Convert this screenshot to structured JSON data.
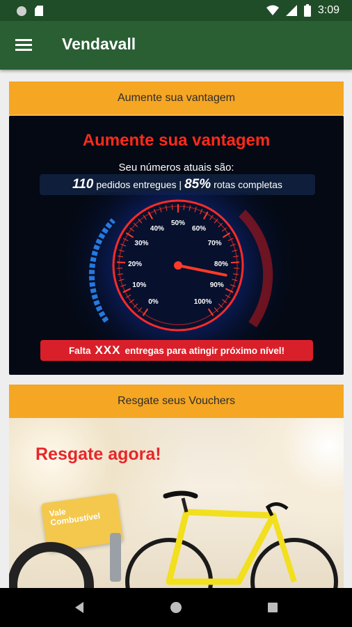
{
  "status_bar": {
    "time": "3:09",
    "left_icons": [
      "circle-icon",
      "sd-card-icon"
    ],
    "right_icons": [
      "wifi-icon",
      "signal-icon",
      "battery-icon"
    ]
  },
  "app_bar": {
    "title": "Vendavall",
    "menu_icon": "hamburger-menu-icon"
  },
  "colors": {
    "status_bar": "#1f4d27",
    "app_bar": "#2a5f34",
    "section_header": "#f5a623",
    "accent_red": "#e8262a"
  },
  "section1": {
    "header": "Aumente sua vantagem",
    "banner": {
      "headline": "Aumente sua vantagem",
      "subline": "Seu números atuais são:",
      "orders_count": "110",
      "orders_label": "pedidos entregues |",
      "routes_percent": "85%",
      "routes_label": "rotas completas",
      "gauge_labels": [
        "0%",
        "10%",
        "20%",
        "30%",
        "40%",
        "50%",
        "60%",
        "70%",
        "80%",
        "90%",
        "100%"
      ],
      "gauge_value_percent": 85,
      "cta_prefix": "Falta",
      "cta_count": "XXX",
      "cta_suffix": "entregas para atingir próximo nível!"
    }
  },
  "section2": {
    "header": "Resgate seus Vouchers",
    "banner": {
      "headline": "Resgate agora!",
      "voucher_line1": "Vale",
      "voucher_line2": "Combustível"
    }
  },
  "nav_bar": {
    "buttons": [
      "back-icon",
      "home-icon",
      "recents-icon"
    ]
  }
}
